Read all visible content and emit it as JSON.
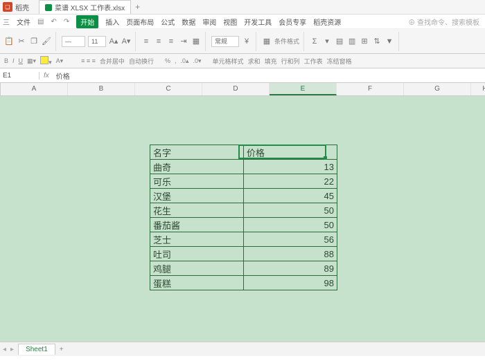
{
  "titlebar": {
    "app": "稻壳",
    "doc": "菜谱 XLSX 工作表.xlsx"
  },
  "menu": {
    "items": [
      "三",
      "文件",
      "开始",
      "插入",
      "页面布局",
      "公式",
      "数据",
      "审阅",
      "视图",
      "开发工具",
      "会员专享",
      "稻壳资源"
    ],
    "active": "开始",
    "search_hint": "⊕ 查找命令、搜索模板"
  },
  "ribbon_labels": {
    "merge": "合并居中",
    "wrap": "自动换行",
    "fmt": "常规",
    "cond": "条件格式",
    "cellfmt": "单元格样式",
    "sum": "求和",
    "fill": "填充",
    "row": "行和列",
    "ws": "工作表",
    "freeze": "冻结窗格"
  },
  "formula": {
    "cell": "E1",
    "fx": "fx",
    "value": "价格"
  },
  "columns": [
    "A",
    "B",
    "C",
    "D",
    "E",
    "F",
    "G",
    "H"
  ],
  "table": {
    "headers": [
      "名字",
      "价格"
    ],
    "rows": [
      [
        "曲奇",
        "13"
      ],
      [
        "可乐",
        "22"
      ],
      [
        "汉堡",
        "45"
      ],
      [
        "花生",
        "50"
      ],
      [
        "番茄酱",
        "50"
      ],
      [
        "芝士",
        "56"
      ],
      [
        "吐司",
        "88"
      ],
      [
        "鸡腿",
        "89"
      ],
      [
        "蛋糕",
        "98"
      ]
    ]
  },
  "sheet": {
    "name": "Sheet1"
  }
}
